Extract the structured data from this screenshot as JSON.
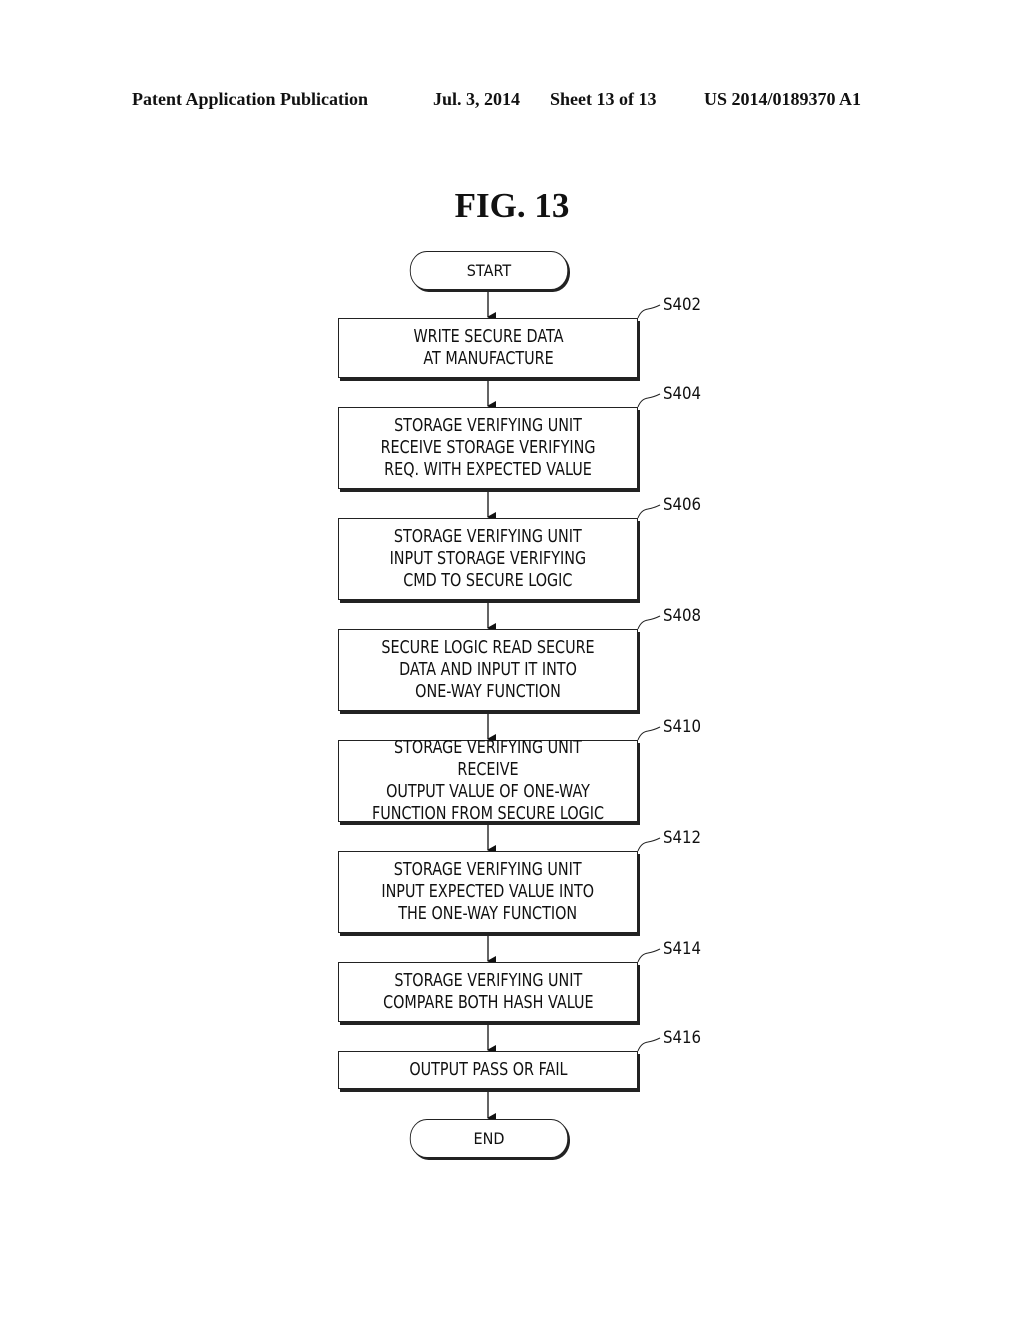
{
  "header": {
    "publication": "Patent Application Publication",
    "date": "Jul. 3, 2014",
    "sheet": "Sheet 13 of 13",
    "number": "US 2014/0189370 A1"
  },
  "figure": {
    "title": "FIG. 13"
  },
  "flowchart": {
    "start": "START",
    "end": "END",
    "steps": [
      {
        "id": "S402",
        "text": "WRITE SECURE DATA\nAT MANUFACTURE"
      },
      {
        "id": "S404",
        "text": "STORAGE VERIFYING UNIT\nRECEIVE STORAGE VERIFYING\nREQ. WITH EXPECTED VALUE"
      },
      {
        "id": "S406",
        "text": "STORAGE VERIFYING UNIT\nINPUT STORAGE VERIFYING\nCMD TO SECURE LOGIC"
      },
      {
        "id": "S408",
        "text": "SECURE LOGIC READ SECURE\nDATA AND INPUT IT INTO\nONE-WAY FUNCTION"
      },
      {
        "id": "S410",
        "text": "STORAGE VERIFYING UNIT RECEIVE\nOUTPUT VALUE OF ONE-WAY\nFUNCTION FROM SECURE LOGIC"
      },
      {
        "id": "S412",
        "text": "STORAGE VERIFYING UNIT\nINPUT EXPECTED VALUE INTO\nTHE ONE-WAY FUNCTION"
      },
      {
        "id": "S414",
        "text": "STORAGE VERIFYING UNIT\nCOMPARE BOTH HASH VALUE"
      },
      {
        "id": "S416",
        "text": "OUTPUT PASS OR FAIL"
      }
    ]
  }
}
